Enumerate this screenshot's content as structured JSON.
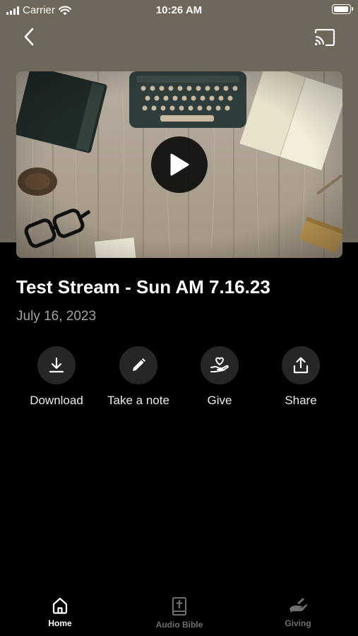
{
  "status_bar": {
    "carrier": "Carrier",
    "time": "10:26 AM",
    "battery_level": 1.0
  },
  "header": {
    "back_icon": "chevron-left-icon",
    "cast_icon": "cast-icon"
  },
  "video": {
    "thumbnail": "desk-flatlay-typewriter-notebook-glasses",
    "play_icon": "play-icon"
  },
  "sermon": {
    "title": "Test Stream - Sun AM 7.16.23",
    "date": "July 16, 2023"
  },
  "actions": [
    {
      "label": "Download",
      "icon": "download-icon"
    },
    {
      "label": "Take a note",
      "icon": "pencil-icon"
    },
    {
      "label": "Give",
      "icon": "hand-heart-icon"
    },
    {
      "label": "Share",
      "icon": "share-icon"
    }
  ],
  "tab_bar": {
    "tabs": [
      {
        "label": "Home",
        "icon": "home-icon",
        "active": true
      },
      {
        "label": "Audio Bible",
        "icon": "bible-icon",
        "active": false
      },
      {
        "label": "Giving",
        "icon": "giving-hand-icon",
        "active": false
      }
    ]
  },
  "colors": {
    "header_background": "#6f675a",
    "page_background": "#000000",
    "action_circle": "#262626",
    "secondary_text": "#a2a2a2",
    "tab_active": "#ffffff",
    "tab_inactive": "#6e6e6e"
  }
}
